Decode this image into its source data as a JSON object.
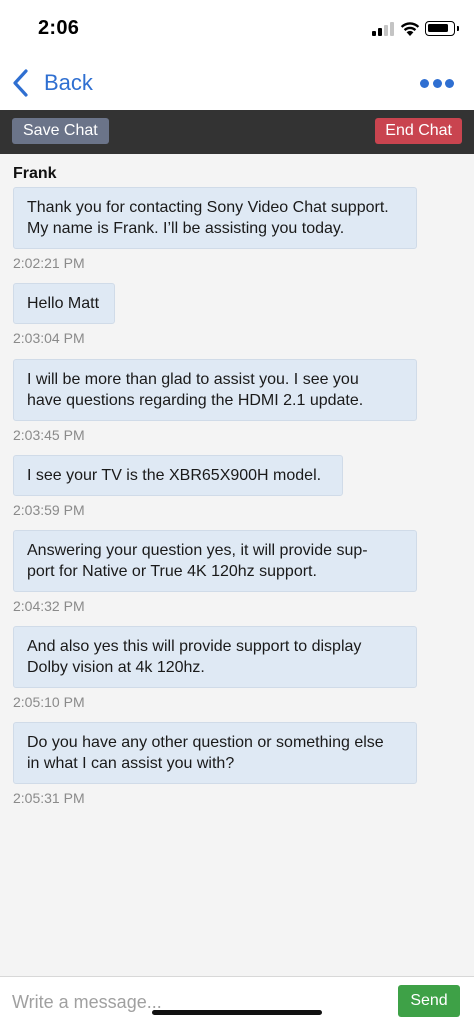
{
  "status_bar": {
    "time": "2:06"
  },
  "nav": {
    "back_label": "Back",
    "accent_color": "#2f6fd1"
  },
  "toolbar": {
    "save_label": "Save Chat",
    "end_label": "End Chat"
  },
  "chat": {
    "agent_name": "Frank",
    "messages": [
      {
        "lines": [
          "Thank you for contacting Sony Video Chat support.",
          "My name is Frank. I’ll be assisting you today."
        ],
        "time": "2:02:21 PM"
      },
      {
        "lines": [
          "Hello Matt"
        ],
        "time": "2:03:04 PM"
      },
      {
        "lines": [
          "I will be more than glad to assist you. I see you",
          "have questions regarding the HDMI 2.1 update."
        ],
        "time": "2:03:45 PM"
      },
      {
        "lines": [
          "I see your TV is the XBR65X900H model."
        ],
        "time": "2:03:59 PM"
      },
      {
        "lines": [
          "Answering your question yes,  it will provide sup-",
          "port for Native or True 4K 120hz support."
        ],
        "time": "2:04:32 PM"
      },
      {
        "lines": [
          "And also yes this will provide support to display",
          "Dolby vision at 4k 120hz."
        ],
        "time": "2:05:10 PM"
      },
      {
        "lines": [
          "Do you have any other question or something else",
          "in what I can assist you with?"
        ],
        "time": "2:05:31 PM"
      }
    ]
  },
  "composer": {
    "placeholder": "Write a message...",
    "value": "",
    "send_label": "Send"
  }
}
